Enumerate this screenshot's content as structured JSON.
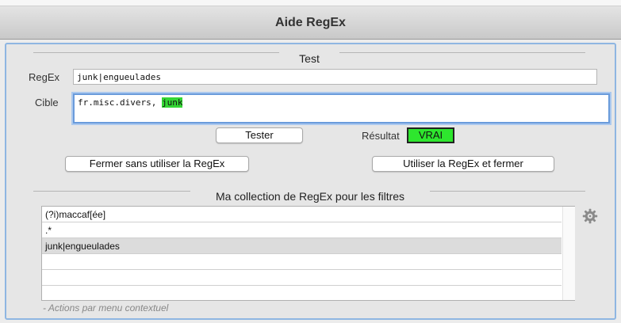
{
  "window": {
    "title": "Aide RegEx"
  },
  "test_section": {
    "title": "Test",
    "regex_label": "RegEx",
    "regex_value": "junk|engueulades",
    "target_label": "Cible",
    "target_prefix": "fr.misc.divers, ",
    "target_match": "junk",
    "test_button": "Tester",
    "result_label": "Résultat",
    "result_value": "VRAI"
  },
  "actions": {
    "close_without": "Fermer sans utiliser la RegEx",
    "use_and_close": "Utiliser la RegEx et fermer"
  },
  "collection": {
    "title": "Ma collection de RegEx pour les filtres",
    "rows": [
      {
        "value": "(?i)maccaf[ée]",
        "selected": false
      },
      {
        "value": ".*",
        "selected": false
      },
      {
        "value": "junk|engueulades",
        "selected": true
      },
      {
        "value": "",
        "selected": false
      },
      {
        "value": "",
        "selected": false
      },
      {
        "value": "",
        "selected": false
      }
    ],
    "hint": "- Actions par menu contextuel"
  },
  "icons": {
    "gear": "gear-icon"
  },
  "colors": {
    "highlight": "#34d634",
    "result_bg": "#2ee62e",
    "focus": "#6a9bdb"
  }
}
